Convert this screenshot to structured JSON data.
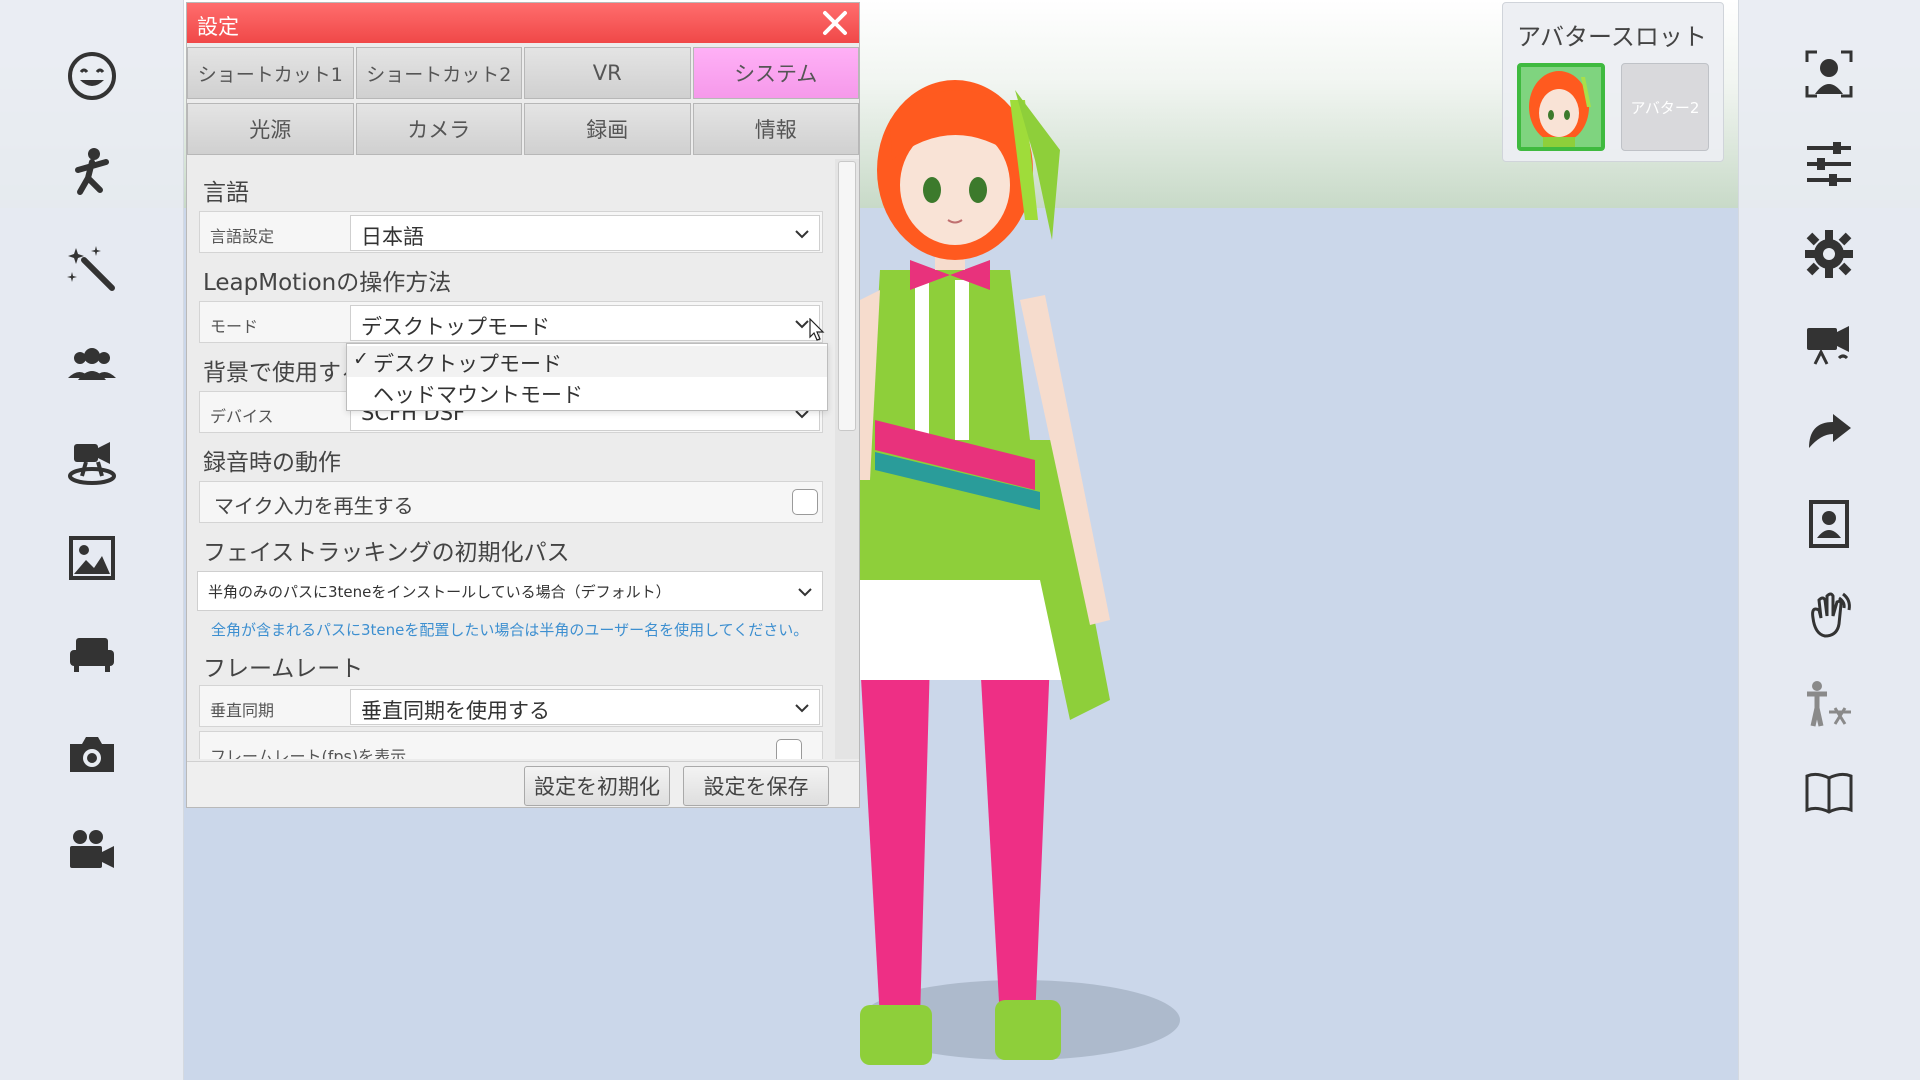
{
  "settings": {
    "title": "設定",
    "tabs_row1": [
      "ショートカット1",
      "ショートカット2",
      "VR",
      "システム"
    ],
    "active_tab": "システム",
    "tabs_row2": [
      "光源",
      "カメラ",
      "録画",
      "情報"
    ],
    "language": {
      "section": "言語",
      "label": "言語設定",
      "value": "日本語"
    },
    "leap": {
      "section": "LeapMotionの操作方法",
      "label": "モード",
      "value": "デスクトップモード",
      "options": [
        "デスクトップモード",
        "ヘッドマウントモード"
      ],
      "checked_mark": "✓"
    },
    "background": {
      "section": "背景で使用する",
      "label": "デバイス",
      "value": "SCFH DSF"
    },
    "recording": {
      "section": "録音時の動作",
      "mic_label": "マイク入力を再生する"
    },
    "facetracking": {
      "section": "フェイストラッキングの初期化パス",
      "value": "半角のみのパスに3teneをインストールしている場合（デフォルト）",
      "note": "全角が含まれるパスに3teneを配置したい場合は半角のユーザー名を使用してください。"
    },
    "framerate": {
      "section": "フレームレート",
      "label": "垂直同期",
      "value": "垂直同期を使用する",
      "fps_label": "フレームレート(fps)を表示"
    },
    "buttons": {
      "reset": "設定を初期化",
      "save": "設定を保存"
    }
  },
  "avatar_slot": {
    "title": "アバタースロット",
    "slot2_label": "アバター2"
  },
  "left_toolbar": [
    "face-icon",
    "pose-icon",
    "effects-icon",
    "group-icon",
    "stage-icon",
    "background-image-icon",
    "furniture-icon",
    "camera-icon",
    "video-camera-icon"
  ],
  "right_toolbar": [
    "face-tracking-icon",
    "sliders-icon",
    "settings-gear-icon",
    "camera-switch-icon",
    "redo-icon",
    "portrait-icon",
    "hand-tracking-icon",
    "body-tracking-icon",
    "manual-icon"
  ],
  "colors": {
    "titlebar": "#f04848",
    "active_tab": "#f599ea",
    "active_slot_border": "#3fba3f",
    "note_text": "#3d8fd0"
  }
}
